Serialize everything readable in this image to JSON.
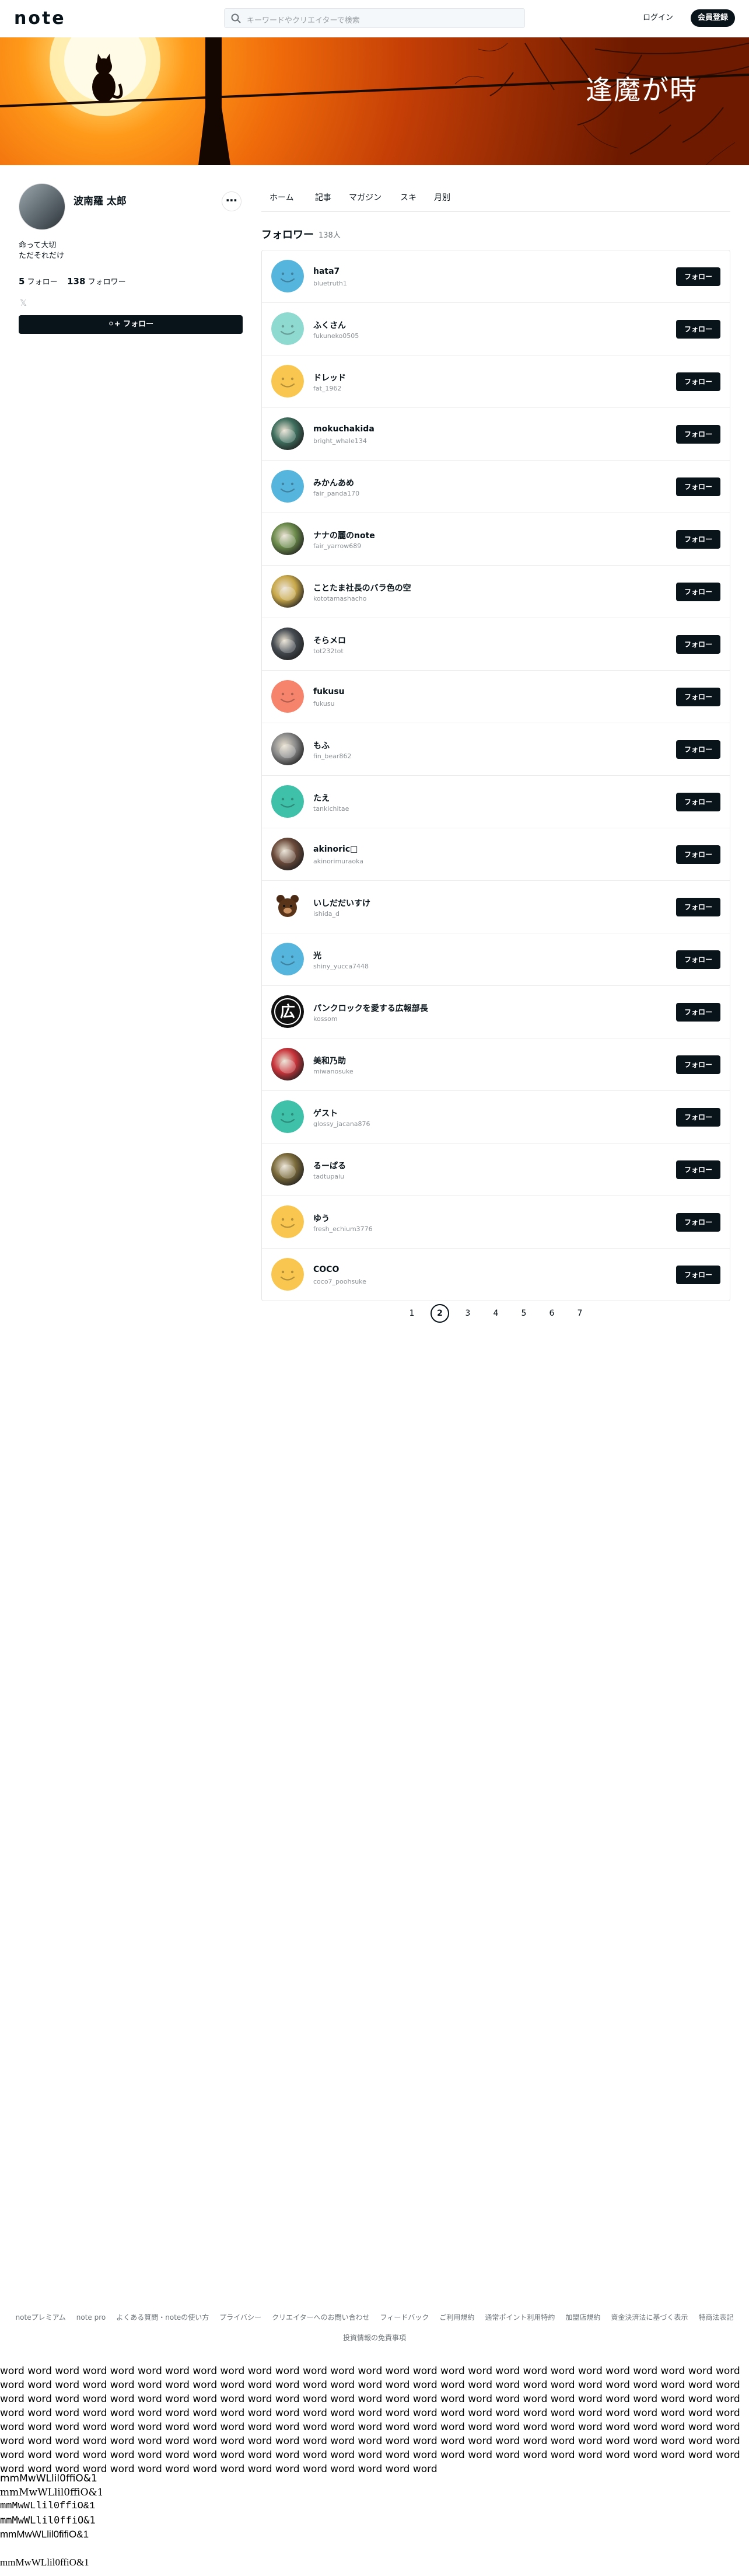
{
  "header": {
    "logo": "note",
    "search_placeholder": "キーワードやクリエイターで検索",
    "login_label": "ログイン",
    "signup_label": "会員登録"
  },
  "banner": {
    "title": "逢魔が時"
  },
  "profile": {
    "name": "波南羅 太郎",
    "more_label": "⋯",
    "bio_line1": "命って大切",
    "bio_line2": "ただそれだけ",
    "follow_count": "5",
    "follow_label": "フォロー",
    "follower_count": "138",
    "follower_label": "フォロワー",
    "x_icon": "𝕏",
    "follow_button": "フォロー"
  },
  "tabs": [
    "ホーム",
    "記事",
    "マガジン",
    "スキ",
    "月別"
  ],
  "section": {
    "title": "フォロワー",
    "count": "138人"
  },
  "followers": [
    {
      "name": "hata7",
      "id": "bluetruth1",
      "avatar": "smile",
      "color": "#56b5dd"
    },
    {
      "name": "ふくさん",
      "id": "fukuneko0505",
      "avatar": "smile",
      "color": "#8fdad0"
    },
    {
      "name": "ドレッド",
      "id": "fat_1962",
      "avatar": "smile",
      "color": "#f9c74f"
    },
    {
      "name": "mokuchakida",
      "id": "bright_whale134",
      "avatar": "photo",
      "color": "#3e6e5e"
    },
    {
      "name": "みかんあめ",
      "id": "fair_panda170",
      "avatar": "smile",
      "color": "#56b5dd"
    },
    {
      "name": "ナナの麗のnote",
      "id": "fair_yarrow689",
      "avatar": "photo",
      "color": "#6a8a4a"
    },
    {
      "name": "ことたま社長のバラ色の空",
      "id": "kototamashacho",
      "avatar": "photo",
      "color": "#c8a84a"
    },
    {
      "name": "そらメロ",
      "id": "tot232tot",
      "avatar": "photo",
      "color": "#444a50"
    },
    {
      "name": "fukusu",
      "id": "fukusu",
      "avatar": "smile",
      "color": "#f6836b"
    },
    {
      "name": "もふ",
      "id": "fin_bear862",
      "avatar": "photo",
      "color": "#8a8a8a"
    },
    {
      "name": "たえ",
      "id": "tankichitae",
      "avatar": "smile",
      "color": "#3fc1a9"
    },
    {
      "name": "akinoric□",
      "id": "akinorimuraoka",
      "avatar": "photo",
      "color": "#6a4a3a"
    },
    {
      "name": "いしだだいすけ",
      "id": "ishida_d",
      "avatar": "bear",
      "color": "#ffffff"
    },
    {
      "name": "光",
      "id": "shiny_yucca7448",
      "avatar": "smile",
      "color": "#56b5dd"
    },
    {
      "name": "パンクロックを愛する広報部長",
      "id": "kossom",
      "avatar": "kanji",
      "color": "#111111"
    },
    {
      "name": "美和乃助",
      "id": "miwanosuke",
      "avatar": "photo",
      "color": "#c8343a"
    },
    {
      "name": "ゲスト",
      "id": "glossy_jacana876",
      "avatar": "smile",
      "color": "#3fc1a9"
    },
    {
      "name": "るーぱる",
      "id": "tadtupaiu",
      "avatar": "photo",
      "color": "#7a6a3a"
    },
    {
      "name": "ゆう",
      "id": "fresh_echium3776",
      "avatar": "smile",
      "color": "#f9c74f"
    },
    {
      "name": "COCO",
      "id": "coco7_poohsuke",
      "avatar": "smile",
      "color": "#f9c74f"
    }
  ],
  "follow_row_label": "フォロー",
  "avatar_kanji": "広",
  "pagination": {
    "pages": [
      "1",
      "2",
      "3",
      "4",
      "5",
      "6",
      "7"
    ],
    "active": "2"
  },
  "footer": {
    "links": [
      "noteプレミアム",
      "note pro",
      "よくある質問・noteの使い方",
      "プライバシー",
      "クリエイターへのお問い合わせ",
      "フィードバック",
      "ご利用規約",
      "通常ポイント利用特約",
      "加盟店規約",
      "資金決済法に基づく表示",
      "特商法表記"
    ],
    "line2": "投資情報の免責事項"
  },
  "filler_words": "word word word word word word word word word word word word word word word word word word word word word word word word word word word word word word word word word word word word word word word word word word word word word word word word word word word word word word word word word word word word word word word word word word word word word word word word word word word word word word word word word word word word word word word word word word word word word word word word word word word word word word word word word word word word word word word word word word word word word word word word word word word word word word word word word word word word word word word word word word word word word word word word word word word word word word word word word word word word word word word word word word word word word word word word word word word word word word word word word word word word word word word word word word word word word word word word word word word word word word word word word word word word word",
  "glyph_lines": [
    "mmMwWLlil0ffiO&1",
    "mmMwWLlil0ffiO&1",
    "mmMwWLlil0ffiO&1",
    "mmMwWLlil0ffiO&1",
    "mmMwWLlil0fifiO&1",
    "",
    "mmMwWLlil0ffiO&1"
  ]
}
